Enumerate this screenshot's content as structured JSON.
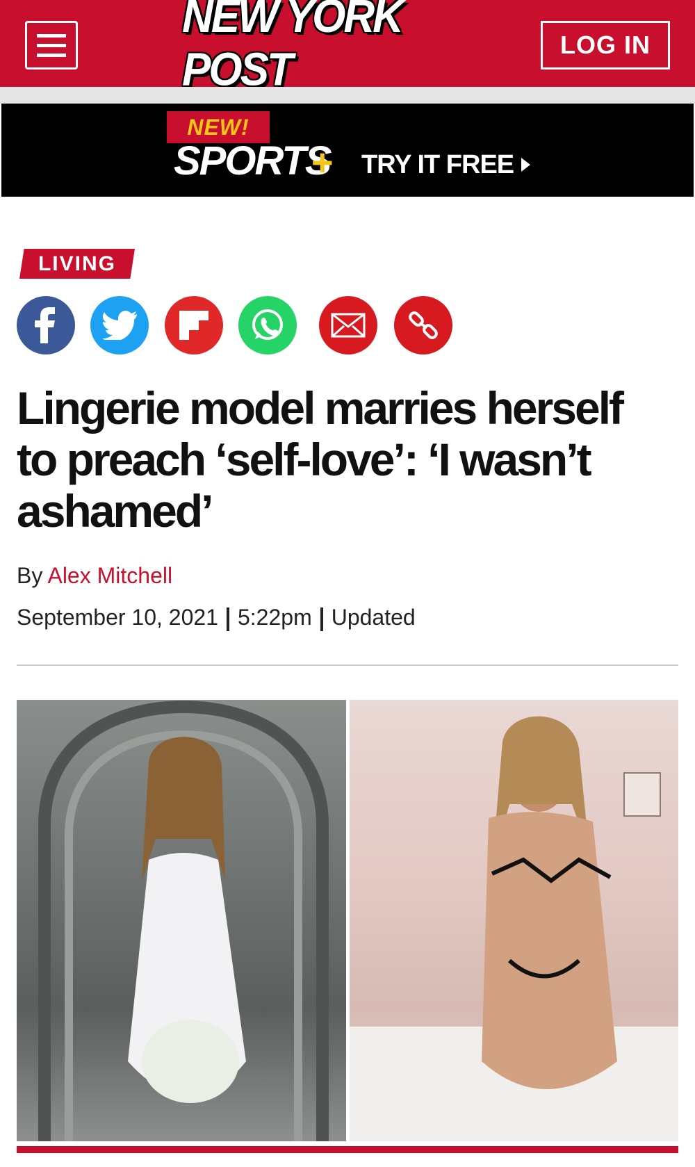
{
  "header": {
    "logo_text": "NEW YORK POST",
    "login_label": "LOG IN",
    "background_color": "#c8102e"
  },
  "promo": {
    "badge": "NEW!",
    "product": "SPORTS",
    "plus": "+",
    "cta": "TRY IT FREE",
    "badge_color": "#c8102e",
    "accent_color": "#f5c518"
  },
  "article": {
    "section_tag": "LIVING",
    "share_icons": [
      "facebook-icon",
      "twitter-icon",
      "flipboard-icon",
      "whatsapp-icon",
      "email-icon",
      "link-icon"
    ],
    "headline": "Lingerie model marries herself to preach ‘self-love’: ‘I wasn’t ashamed’",
    "byline_prefix": "By",
    "author": "Alex Mitchell",
    "date": "September 10, 2021",
    "time": "5:22pm",
    "updated_label": "Updated"
  }
}
